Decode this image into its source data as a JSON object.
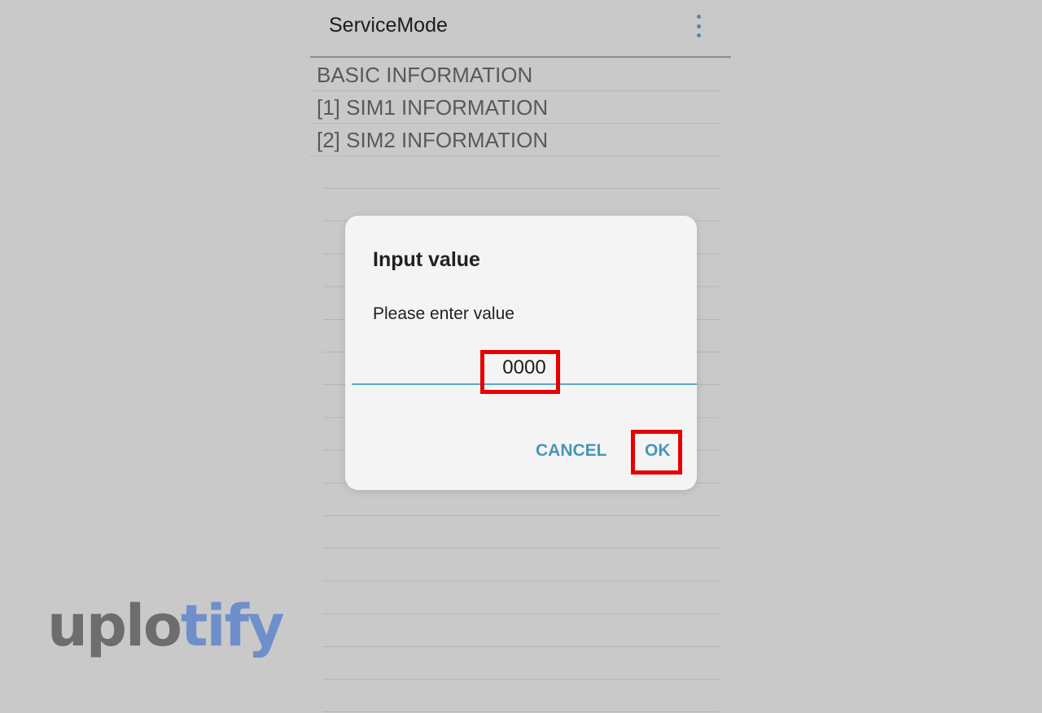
{
  "app_bar": {
    "title": "ServiceMode",
    "overflow_icon": "more-vert-icon",
    "overflow_color": "#4f88a6"
  },
  "menu": {
    "items": [
      {
        "label": "BASIC INFORMATION"
      },
      {
        "label": "[1] SIM1 INFORMATION"
      },
      {
        "label": "[2] SIM2 INFORMATION"
      }
    ]
  },
  "dialog": {
    "title": "Input value",
    "message": "Please enter value",
    "input_value": "0000",
    "cancel_label": "CANCEL",
    "ok_label": "OK",
    "accent_color": "#4797b6",
    "highlight_color": "#e60000"
  },
  "watermark": {
    "part1": "uplo",
    "part2": "tify",
    "part1_color": "#6d6d6d",
    "part2_color": "#6f8fcc"
  }
}
